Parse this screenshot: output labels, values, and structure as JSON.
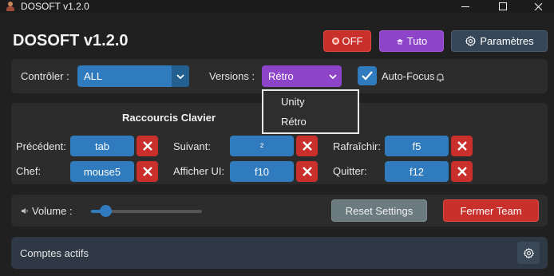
{
  "window": {
    "title": "DOSOFT v1.2.0",
    "icon": "app-character-icon"
  },
  "header": {
    "title": "DOSOFT v1.2.0",
    "off_label": "OFF",
    "tuto_label": "Tuto",
    "params_label": "Paramètres"
  },
  "top_bar": {
    "controller_label": "Contrôler :",
    "controller_value": "ALL",
    "versions_label": "Versions :",
    "versions_value": "Rétro",
    "autofocus_label": "Auto-Focus",
    "autofocus_checked": true,
    "versions_options": [
      "Unity",
      "Rétro"
    ]
  },
  "shortcuts": {
    "title": "Raccourcis Clavier",
    "items": [
      {
        "label": "Précédent:",
        "key": "tab"
      },
      {
        "label": "Suivant:",
        "key": "²"
      },
      {
        "label": "Rafraîchir:",
        "key": "f5"
      },
      {
        "label": "Chef:",
        "key": "mouse5"
      },
      {
        "label": "Afficher UI:",
        "key": "f10"
      },
      {
        "label": "Quitter:",
        "key": "f12"
      }
    ]
  },
  "volume": {
    "label": "Volume :",
    "level": 0.13
  },
  "actions": {
    "reset_label": "Reset Settings",
    "fermer_label": "Fermer Team"
  },
  "accounts": {
    "title": "Comptes actifs"
  },
  "colors": {
    "blue": "#2f7bbd",
    "purple": "#8e44c8",
    "red": "#c9302c",
    "slate": "#37475a"
  }
}
